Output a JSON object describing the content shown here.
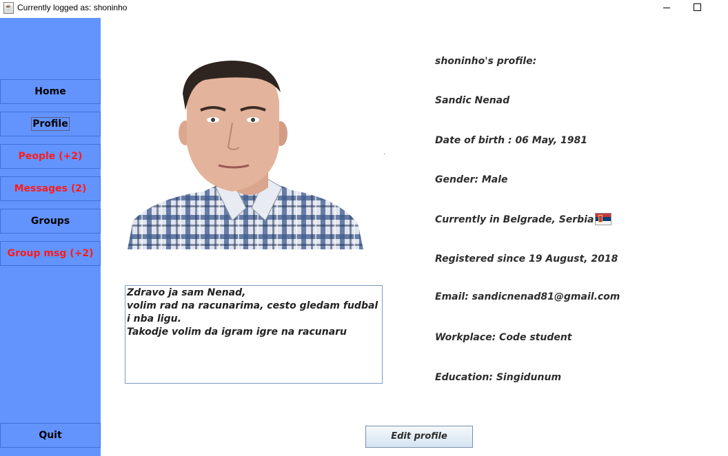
{
  "window": {
    "title": "Currently logged as: shoninho",
    "app_icon": "java-icon"
  },
  "sidebar": {
    "items": [
      {
        "label": "Home"
      },
      {
        "label": "Profile"
      },
      {
        "label": "People (+2)"
      },
      {
        "label": "Messages (2)"
      },
      {
        "label": "Groups"
      },
      {
        "label": "Group msg (+2)"
      },
      {
        "label": "Quit"
      }
    ],
    "background": "#6394fe",
    "alert_color": "#ff1a1a"
  },
  "profile": {
    "header": "shoninho's profile:",
    "name": "Sandic Nenad",
    "dob": "Date of birth : 06 May, 1981",
    "gender": "Gender: Male",
    "location": "Currently in Belgrade, Serbia",
    "location_flag": "serbia-flag-icon",
    "registered": "Registered since 19 August, 2018",
    "email": "Email: sandicnenad81@gmail.com",
    "workplace": "Workplace: Code student",
    "education": "Education: Singidunum"
  },
  "bio": {
    "text": "Zdravo ja sam Nenad,\nvolim rad na racunarima, cesto gledam fudbal i nba ligu.\nTakodje volim da igram igre na racunaru"
  },
  "actions": {
    "edit_profile": "Edit profile"
  }
}
